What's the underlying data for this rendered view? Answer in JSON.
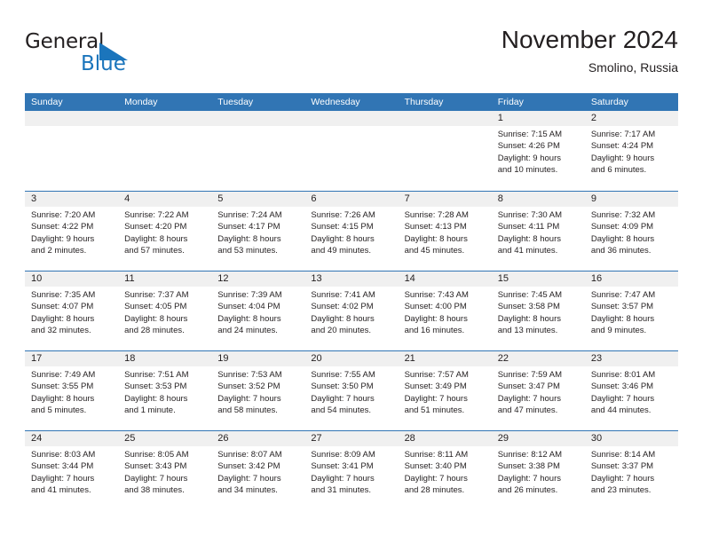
{
  "brand": {
    "name_top": "General",
    "name_bottom": "Blue",
    "triangle_icon": "blue-triangle-logo-mark",
    "color_dark": "#231f20",
    "color_blue": "#1b75bc"
  },
  "header": {
    "title": "November 2024",
    "subtitle": "Smolino, Russia"
  },
  "theme": {
    "header_blue": "#3175b4",
    "daynum_band": "#f0f0f0",
    "text": "#231f20",
    "cell_bg": "#ffffff"
  },
  "calendar": {
    "weekday_headers": [
      "Sunday",
      "Monday",
      "Tuesday",
      "Wednesday",
      "Thursday",
      "Friday",
      "Saturday"
    ],
    "weeks": [
      [
        {
          "day": "",
          "lines": []
        },
        {
          "day": "",
          "lines": []
        },
        {
          "day": "",
          "lines": []
        },
        {
          "day": "",
          "lines": []
        },
        {
          "day": "",
          "lines": []
        },
        {
          "day": "1",
          "lines": [
            "Sunrise: 7:15 AM",
            "Sunset: 4:26 PM",
            "Daylight: 9 hours",
            "and 10 minutes."
          ]
        },
        {
          "day": "2",
          "lines": [
            "Sunrise: 7:17 AM",
            "Sunset: 4:24 PM",
            "Daylight: 9 hours",
            "and 6 minutes."
          ]
        }
      ],
      [
        {
          "day": "3",
          "lines": [
            "Sunrise: 7:20 AM",
            "Sunset: 4:22 PM",
            "Daylight: 9 hours",
            "and 2 minutes."
          ]
        },
        {
          "day": "4",
          "lines": [
            "Sunrise: 7:22 AM",
            "Sunset: 4:20 PM",
            "Daylight: 8 hours",
            "and 57 minutes."
          ]
        },
        {
          "day": "5",
          "lines": [
            "Sunrise: 7:24 AM",
            "Sunset: 4:17 PM",
            "Daylight: 8 hours",
            "and 53 minutes."
          ]
        },
        {
          "day": "6",
          "lines": [
            "Sunrise: 7:26 AM",
            "Sunset: 4:15 PM",
            "Daylight: 8 hours",
            "and 49 minutes."
          ]
        },
        {
          "day": "7",
          "lines": [
            "Sunrise: 7:28 AM",
            "Sunset: 4:13 PM",
            "Daylight: 8 hours",
            "and 45 minutes."
          ]
        },
        {
          "day": "8",
          "lines": [
            "Sunrise: 7:30 AM",
            "Sunset: 4:11 PM",
            "Daylight: 8 hours",
            "and 41 minutes."
          ]
        },
        {
          "day": "9",
          "lines": [
            "Sunrise: 7:32 AM",
            "Sunset: 4:09 PM",
            "Daylight: 8 hours",
            "and 36 minutes."
          ]
        }
      ],
      [
        {
          "day": "10",
          "lines": [
            "Sunrise: 7:35 AM",
            "Sunset: 4:07 PM",
            "Daylight: 8 hours",
            "and 32 minutes."
          ]
        },
        {
          "day": "11",
          "lines": [
            "Sunrise: 7:37 AM",
            "Sunset: 4:05 PM",
            "Daylight: 8 hours",
            "and 28 minutes."
          ]
        },
        {
          "day": "12",
          "lines": [
            "Sunrise: 7:39 AM",
            "Sunset: 4:04 PM",
            "Daylight: 8 hours",
            "and 24 minutes."
          ]
        },
        {
          "day": "13",
          "lines": [
            "Sunrise: 7:41 AM",
            "Sunset: 4:02 PM",
            "Daylight: 8 hours",
            "and 20 minutes."
          ]
        },
        {
          "day": "14",
          "lines": [
            "Sunrise: 7:43 AM",
            "Sunset: 4:00 PM",
            "Daylight: 8 hours",
            "and 16 minutes."
          ]
        },
        {
          "day": "15",
          "lines": [
            "Sunrise: 7:45 AM",
            "Sunset: 3:58 PM",
            "Daylight: 8 hours",
            "and 13 minutes."
          ]
        },
        {
          "day": "16",
          "lines": [
            "Sunrise: 7:47 AM",
            "Sunset: 3:57 PM",
            "Daylight: 8 hours",
            "and 9 minutes."
          ]
        }
      ],
      [
        {
          "day": "17",
          "lines": [
            "Sunrise: 7:49 AM",
            "Sunset: 3:55 PM",
            "Daylight: 8 hours",
            "and 5 minutes."
          ]
        },
        {
          "day": "18",
          "lines": [
            "Sunrise: 7:51 AM",
            "Sunset: 3:53 PM",
            "Daylight: 8 hours",
            "and 1 minute."
          ]
        },
        {
          "day": "19",
          "lines": [
            "Sunrise: 7:53 AM",
            "Sunset: 3:52 PM",
            "Daylight: 7 hours",
            "and 58 minutes."
          ]
        },
        {
          "day": "20",
          "lines": [
            "Sunrise: 7:55 AM",
            "Sunset: 3:50 PM",
            "Daylight: 7 hours",
            "and 54 minutes."
          ]
        },
        {
          "day": "21",
          "lines": [
            "Sunrise: 7:57 AM",
            "Sunset: 3:49 PM",
            "Daylight: 7 hours",
            "and 51 minutes."
          ]
        },
        {
          "day": "22",
          "lines": [
            "Sunrise: 7:59 AM",
            "Sunset: 3:47 PM",
            "Daylight: 7 hours",
            "and 47 minutes."
          ]
        },
        {
          "day": "23",
          "lines": [
            "Sunrise: 8:01 AM",
            "Sunset: 3:46 PM",
            "Daylight: 7 hours",
            "and 44 minutes."
          ]
        }
      ],
      [
        {
          "day": "24",
          "lines": [
            "Sunrise: 8:03 AM",
            "Sunset: 3:44 PM",
            "Daylight: 7 hours",
            "and 41 minutes."
          ]
        },
        {
          "day": "25",
          "lines": [
            "Sunrise: 8:05 AM",
            "Sunset: 3:43 PM",
            "Daylight: 7 hours",
            "and 38 minutes."
          ]
        },
        {
          "day": "26",
          "lines": [
            "Sunrise: 8:07 AM",
            "Sunset: 3:42 PM",
            "Daylight: 7 hours",
            "and 34 minutes."
          ]
        },
        {
          "day": "27",
          "lines": [
            "Sunrise: 8:09 AM",
            "Sunset: 3:41 PM",
            "Daylight: 7 hours",
            "and 31 minutes."
          ]
        },
        {
          "day": "28",
          "lines": [
            "Sunrise: 8:11 AM",
            "Sunset: 3:40 PM",
            "Daylight: 7 hours",
            "and 28 minutes."
          ]
        },
        {
          "day": "29",
          "lines": [
            "Sunrise: 8:12 AM",
            "Sunset: 3:38 PM",
            "Daylight: 7 hours",
            "and 26 minutes."
          ]
        },
        {
          "day": "30",
          "lines": [
            "Sunrise: 8:14 AM",
            "Sunset: 3:37 PM",
            "Daylight: 7 hours",
            "and 23 minutes."
          ]
        }
      ]
    ]
  }
}
